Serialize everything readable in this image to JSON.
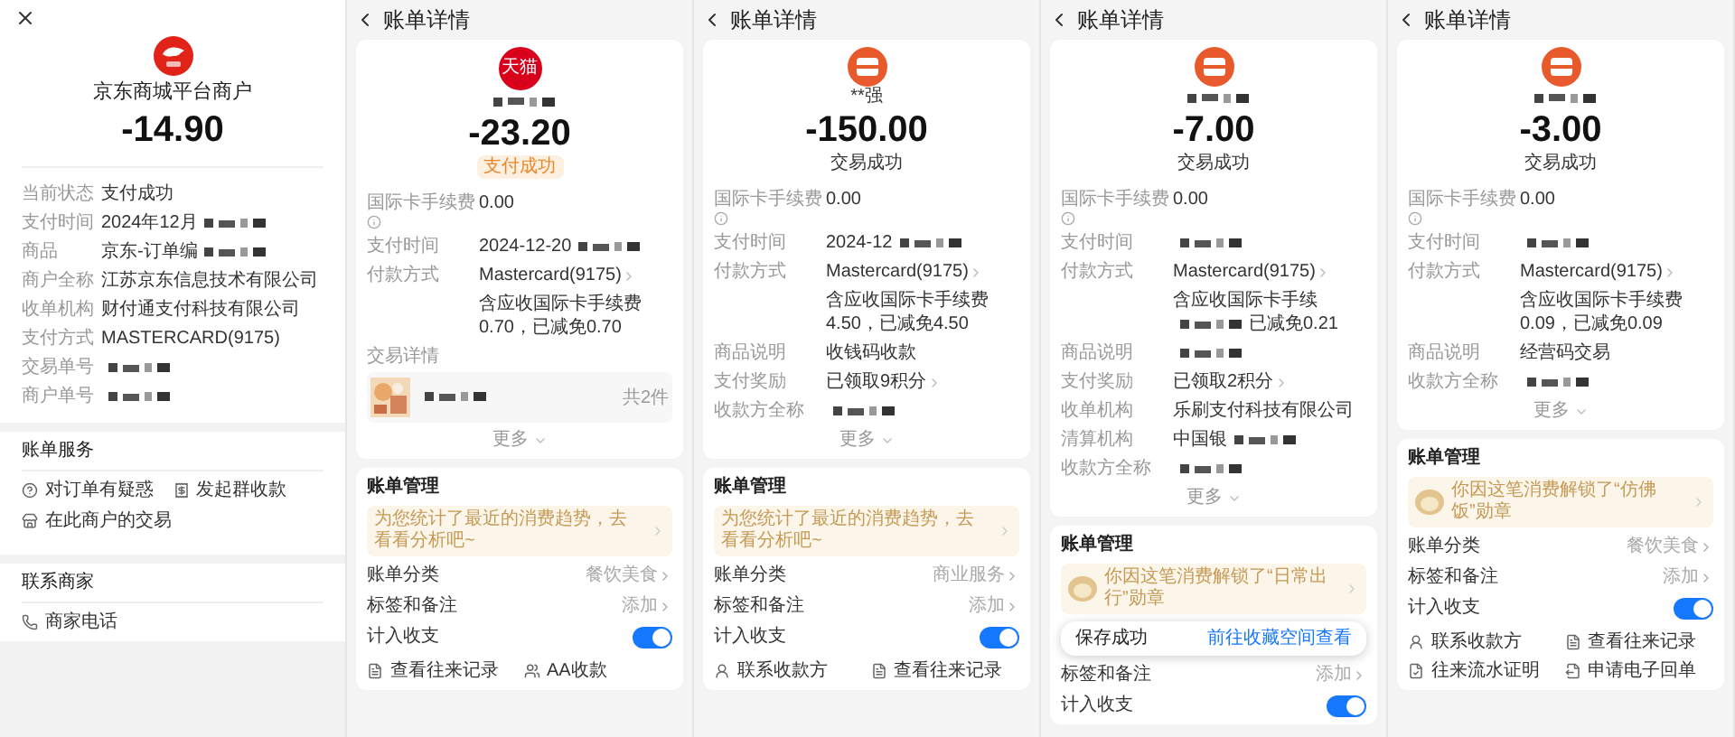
{
  "screens": [
    {
      "kind": "receipt",
      "merchant": "京东商城平台商户",
      "amount": "-14.90",
      "rows": [
        {
          "label": "当前状态",
          "value": "支付成功"
        },
        {
          "label": "支付时间",
          "value": "2024年12月",
          "redacted": true
        },
        {
          "label": "商品",
          "value": "京东-订单编",
          "redacted": true
        },
        {
          "label": "商户全称",
          "value": "江苏京东信息技术有限公司"
        },
        {
          "label": "收单机构",
          "value": "财付通支付科技有限公司"
        },
        {
          "label": "支付方式",
          "value": "MASTERCARD(9175)"
        },
        {
          "label": "交易单号",
          "redacted": true
        },
        {
          "label": "商户单号",
          "redacted": true
        }
      ],
      "sections": [
        {
          "title": "账单服务",
          "actions": [
            {
              "label": "对订单有疑惑"
            },
            {
              "label": "发起群收款"
            },
            {
              "label": "在此商户的交易"
            }
          ]
        },
        {
          "title": "联系商家",
          "actions": [
            {
              "label": "商家电话"
            }
          ]
        }
      ]
    },
    {
      "kind": "bill",
      "title": "账单详情",
      "logo_text": "天猫",
      "name_redacted": true,
      "amount": "-23.20",
      "status": "支付成功",
      "status_highlight": true,
      "rows": [
        {
          "kind": "field",
          "label": "国际卡手续费",
          "info": true,
          "value": "0.00"
        },
        {
          "kind": "field",
          "label": "支付时间",
          "value": "2024-12-20",
          "redacted": true
        },
        {
          "kind": "field",
          "label": "付款方式",
          "value": "Mastercard(9175)",
          "link": true
        },
        {
          "kind": "note",
          "value": "含应收国际卡手续费0.70，已减免0.70"
        }
      ],
      "goods": {
        "label": "交易详情",
        "count": "共2件"
      },
      "more": "更多",
      "manage": {
        "title": "账单管理",
        "banner": {
          "text": "为您统计了最近的消费趋势，去看看分析吧~",
          "mascot": false
        },
        "rows": [
          {
            "kind": "link",
            "label": "账单分类",
            "value": "餐饮美食"
          },
          {
            "kind": "link",
            "label": "标签和备注",
            "value": "添加"
          },
          {
            "kind": "toggle",
            "label": "计入收支",
            "on": true
          }
        ],
        "actions": [
          {
            "label": "查看往来记录"
          },
          {
            "label": "AA收款"
          }
        ]
      }
    },
    {
      "kind": "bill",
      "title": "账单详情",
      "name": "**强",
      "name_redacted": false,
      "amount": "-150.00",
      "status": "交易成功",
      "status_highlight": false,
      "rows": [
        {
          "kind": "field",
          "label": "国际卡手续费",
          "info": true,
          "value": "0.00"
        },
        {
          "kind": "field",
          "label": "支付时间",
          "value": "2024-12",
          "redacted": true
        },
        {
          "kind": "field",
          "label": "付款方式",
          "value": "Mastercard(9175)",
          "link": true
        },
        {
          "kind": "note",
          "value": "含应收国际卡手续费4.50，已减免4.50"
        },
        {
          "kind": "field",
          "label": "商品说明",
          "value": "收钱码收款"
        },
        {
          "kind": "field",
          "label": "支付奖励",
          "value": "已领取9积分",
          "link": true
        },
        {
          "kind": "field",
          "label": "收款方全称",
          "redacted": true
        }
      ],
      "more": "更多",
      "manage": {
        "title": "账单管理",
        "banner": {
          "text": "为您统计了最近的消费趋势，去看看分析吧~",
          "mascot": false
        },
        "rows": [
          {
            "kind": "link",
            "label": "账单分类",
            "value": "商业服务"
          },
          {
            "kind": "link",
            "label": "标签和备注",
            "value": "添加"
          },
          {
            "kind": "toggle",
            "label": "计入收支",
            "on": true
          }
        ],
        "actions": [
          {
            "label": "联系收款方"
          },
          {
            "label": "查看往来记录"
          }
        ]
      }
    },
    {
      "kind": "bill",
      "title": "账单详情",
      "name_redacted": true,
      "amount": "-7.00",
      "status": "交易成功",
      "status_highlight": false,
      "rows": [
        {
          "kind": "field",
          "label": "国际卡手续费",
          "info": true,
          "value": "0.00"
        },
        {
          "kind": "field",
          "label": "支付时间",
          "redacted": true
        },
        {
          "kind": "field",
          "label": "付款方式",
          "value": "Mastercard(9175)",
          "link": true
        },
        {
          "kind": "note",
          "value": "含应收国际卡手续",
          "redacted": true,
          "suffix": "已减免0.21"
        },
        {
          "kind": "field",
          "label": "商品说明",
          "redacted": true
        },
        {
          "kind": "field",
          "label": "支付奖励",
          "value": "已领取2积分",
          "link": true
        },
        {
          "kind": "field",
          "label": "收单机构",
          "value": "乐刷支付科技有限公司"
        },
        {
          "kind": "field",
          "label": "清算机构",
          "value": "中国银",
          "redacted": true
        },
        {
          "kind": "field",
          "label": "收款方全称",
          "redacted": true
        }
      ],
      "more": "更多",
      "manage": {
        "title": "账单管理",
        "banner": {
          "text": "你因这笔消费解锁了“日常出行”勋章",
          "mascot": true
        },
        "toast": {
          "text": "保存成功",
          "link": "前往收藏空间查看"
        },
        "rows": [
          {
            "kind": "link",
            "label": "标签和备注",
            "value": "添加"
          },
          {
            "kind": "toggle",
            "label": "计入收支",
            "on": true
          }
        ]
      }
    },
    {
      "kind": "bill",
      "title": "账单详情",
      "name_redacted": true,
      "amount": "-3.00",
      "status": "交易成功",
      "status_highlight": false,
      "rows": [
        {
          "kind": "field",
          "label": "国际卡手续费",
          "info": true,
          "value": "0.00"
        },
        {
          "kind": "field",
          "label": "支付时间",
          "redacted": true
        },
        {
          "kind": "field",
          "label": "付款方式",
          "value": "Mastercard(9175)",
          "link": true
        },
        {
          "kind": "note",
          "value": "含应收国际卡手续费0.09，已减免0.09"
        },
        {
          "kind": "field",
          "label": "商品说明",
          "value": "经营码交易"
        },
        {
          "kind": "field",
          "label": "收款方全称",
          "redacted": true
        }
      ],
      "more": "更多",
      "manage": {
        "title": "账单管理",
        "banner": {
          "text": "你因这笔消费解锁了“仿佛饭”勋章",
          "mascot": true
        },
        "rows": [
          {
            "kind": "link",
            "label": "账单分类",
            "value": "餐饮美食"
          },
          {
            "kind": "link",
            "label": "标签和备注",
            "value": "添加"
          },
          {
            "kind": "toggle",
            "label": "计入收支",
            "on": true
          }
        ],
        "actions": [
          {
            "label": "联系收款方"
          },
          {
            "label": "查看往来记录"
          },
          {
            "label": "往来流水证明"
          },
          {
            "label": "申请电子回单"
          }
        ]
      }
    }
  ]
}
